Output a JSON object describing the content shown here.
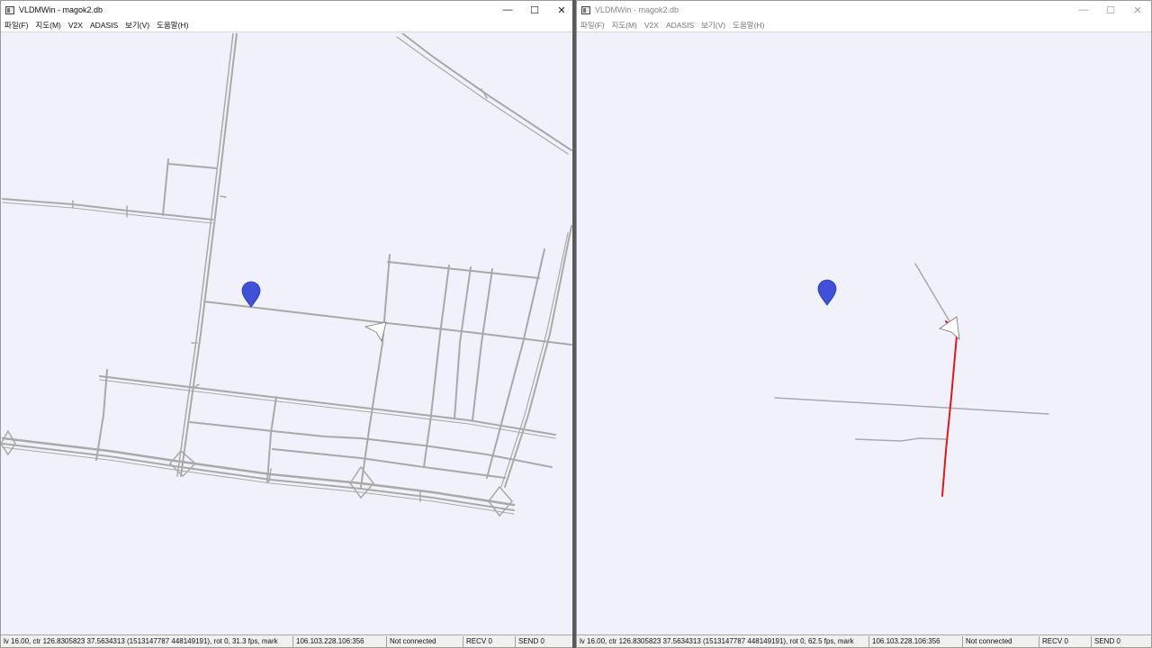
{
  "left": {
    "title": "VLDMWin - magok2.db",
    "menu": [
      "파일(F)",
      "지도(M)",
      "V2X",
      "ADASIS",
      "보기(V)",
      "도움말(H)"
    ],
    "status": {
      "main": "lv 16.00, ctr 126.8305823 37.5634313 (1513147787 448149191), rot 0, 31.3 fps, mark",
      "ip": "106.103.228.106:356",
      "connection": "Not connected",
      "recv": "RECV 0",
      "send": "SEND 0"
    }
  },
  "right": {
    "title": "VLDMWin - magok2.db",
    "menu": [
      "파일(F)",
      "지도(M)",
      "V2X",
      "ADASIS",
      "보기(V)",
      "도움말(H)"
    ],
    "status": {
      "main": "lv 16.00, ctr 126.8305823 37.5634313 (1513147787 448149191), rot 0, 62.5 fps, mark",
      "ip": "106.103.228.106:356",
      "connection": "Not connected",
      "recv": "RECV 0",
      "send": "SEND 0"
    }
  },
  "window_controls": {
    "minimize": "—",
    "maximize": "☐",
    "close": "✕"
  },
  "colors": {
    "road": "#a8a8a8",
    "marker": "#3f51d8",
    "route": "#e01a1a",
    "map_bg": "#f1f1fb"
  },
  "icons": {
    "marker": "map-pin-icon",
    "vehicle": "vehicle-arrow-icon"
  }
}
